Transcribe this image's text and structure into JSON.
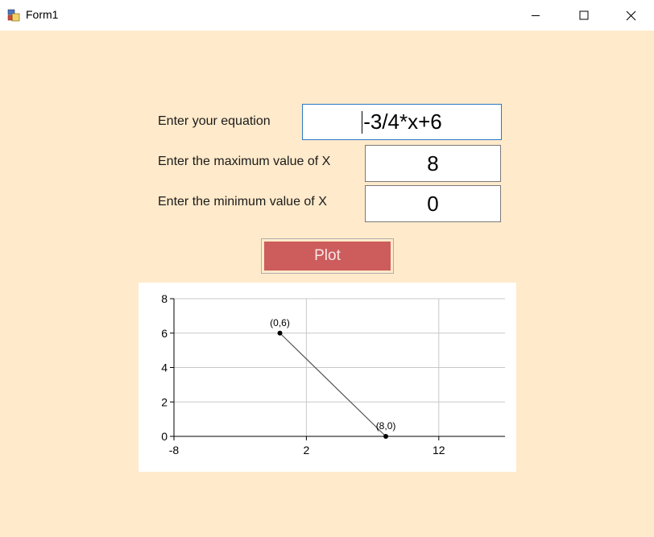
{
  "window": {
    "title": "Form1"
  },
  "form": {
    "equation_label": "Enter your equation",
    "equation_value": "-3/4*x+6",
    "max_label": "Enter the maximum value of X",
    "max_value": "8",
    "min_label": "Enter the minimum value of X",
    "min_value": "0",
    "plot_button": "Plot"
  },
  "colors": {
    "background": "#ffeacb",
    "plot_button": "#cd5c5c",
    "focus_border": "#2a79c4"
  },
  "chart_data": {
    "type": "line",
    "title": "",
    "xlabel": "",
    "ylabel": "",
    "xlim": [
      -8,
      17
    ],
    "ylim": [
      0,
      8
    ],
    "x_ticks": [
      "-8",
      "2",
      "12"
    ],
    "y_ticks": [
      "0",
      "2",
      "4",
      "6",
      "8"
    ],
    "grid": true,
    "series": [
      {
        "x": [
          0,
          8
        ],
        "y": [
          6,
          0
        ],
        "point_labels": [
          "(0,6)",
          "(8,0)"
        ]
      }
    ]
  }
}
